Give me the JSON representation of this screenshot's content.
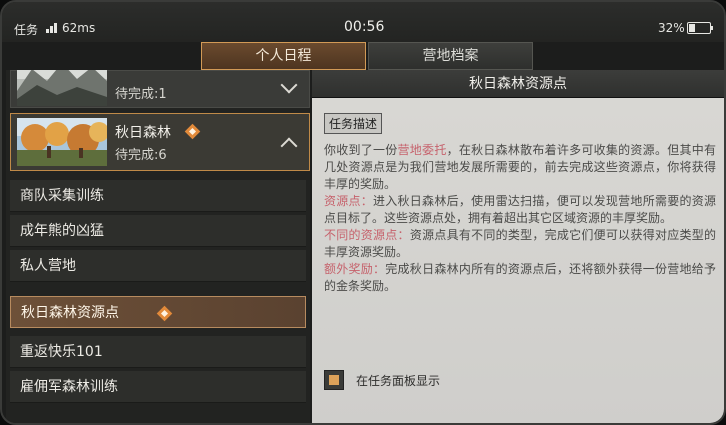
{
  "status_bar": {
    "app": "任务",
    "ping": "62ms",
    "time": "00:56",
    "battery": "32%"
  },
  "tabs": [
    {
      "label": "个人日程",
      "active": true
    },
    {
      "label": "营地档案",
      "active": false
    }
  ],
  "areas": [
    {
      "name": "",
      "count_label": "待完成:1"
    },
    {
      "name": "秋日森林",
      "count_label": "待完成:6"
    }
  ],
  "tasks": [
    {
      "label": "商队采集训练"
    },
    {
      "label": "成年熊的凶猛"
    },
    {
      "label": "私人营地"
    },
    {
      "label": "秋日森林资源点"
    },
    {
      "label": "重返快乐101"
    },
    {
      "label": "雇佣军森林训练"
    }
  ],
  "detail": {
    "title": "秋日森林资源点",
    "section_label": "任务描述",
    "intro_pre": "你收到了一份",
    "intro_hl": "营地委托",
    "intro_post": "，在秋日森林散布着许多可收集的资源。但其中有几处资源点是为我们营地发展所需要的，前去完成这些资源点，你将获得丰厚的奖励。",
    "p1_hl": "资源点：",
    "p1": "进入秋日森林后，使用雷达扫描，便可以发现营地所需要的资源点目标了。这些资源点处，拥有着超出其它区域资源的丰厚奖励。",
    "p2_hl": "不同的资源点：",
    "p2": "资源点具有不同的类型，完成它们便可以获得对应类型的丰厚资源奖励。",
    "p3_hl": "额外奖励：",
    "p3": "完成秋日森林内所有的资源点后，还将额外获得一份营地给予的金条奖励。",
    "checkbox_label": "在任务面板显示"
  },
  "colors": {
    "accent": "#d29a56",
    "highlight_text": "#c6626c"
  }
}
